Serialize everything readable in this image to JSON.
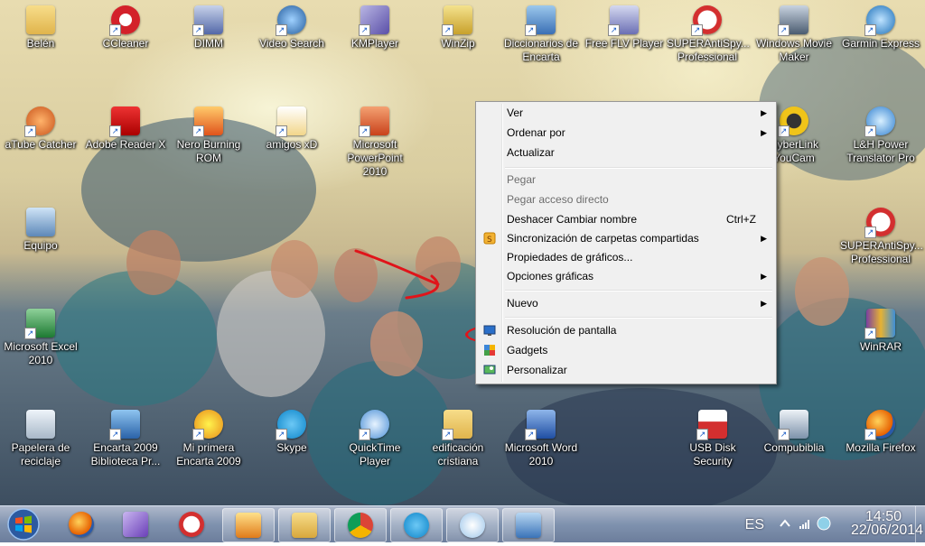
{
  "desktop": {
    "icons": [
      {
        "label": "Belén",
        "icon": "folder-icon"
      },
      {
        "label": "CCleaner",
        "icon": "ccleaner-icon"
      },
      {
        "label": "DIMM",
        "icon": "dimm-icon"
      },
      {
        "label": "Video Search",
        "icon": "video-search-icon"
      },
      {
        "label": "KMPlayer",
        "icon": "kmplayer-icon"
      },
      {
        "label": "WinZip",
        "icon": "winzip-icon"
      },
      {
        "label": "Diccionarios de Encarta",
        "icon": "encarta-dictionary-icon"
      },
      {
        "label": "Free FLV Player",
        "icon": "flv-player-icon"
      },
      {
        "label": "SUPERAntiSpy... Professional",
        "icon": "superantispyware-icon"
      },
      {
        "label": "Windows Movie Maker",
        "icon": "movie-maker-icon"
      },
      {
        "label": "Garmin Express",
        "icon": "garmin-icon"
      },
      {
        "label": "aTube Catcher",
        "icon": "atube-catcher-icon"
      },
      {
        "label": "Adobe Reader X",
        "icon": "adobe-reader-icon"
      },
      {
        "label": "Nero Burning ROM",
        "icon": "nero-icon"
      },
      {
        "label": "amigos xD",
        "icon": "image-file-icon"
      },
      {
        "label": "Microsoft PowerPoint 2010",
        "icon": "powerpoint-icon"
      },
      {
        "label": "CyberLink YouCam",
        "icon": "youcam-icon"
      },
      {
        "label": "L&H Power Translator Pro",
        "icon": "translator-icon"
      },
      {
        "label": "Equipo",
        "icon": "computer-icon"
      },
      {
        "label": "SUPERAntiSpy... Professional",
        "icon": "superantispyware-icon"
      },
      {
        "label": "Microsoft Excel 2010",
        "icon": "excel-icon"
      },
      {
        "label": "WinRAR",
        "icon": "winrar-icon"
      },
      {
        "label": "Papelera de reciclaje",
        "icon": "recycle-bin-icon"
      },
      {
        "label": "Encarta 2009 Biblioteca Pr...",
        "icon": "encarta-icon"
      },
      {
        "label": "Mi primera Encarta 2009",
        "icon": "encarta-kids-icon"
      },
      {
        "label": "Skype",
        "icon": "skype-icon"
      },
      {
        "label": "QuickTime Player",
        "icon": "quicktime-icon"
      },
      {
        "label": "edificación cristiana",
        "icon": "folder-icon"
      },
      {
        "label": "Microsoft Word 2010",
        "icon": "word-icon"
      },
      {
        "label": "USB Disk Security",
        "icon": "usb-security-icon"
      },
      {
        "label": "Compubiblia",
        "icon": "compubiblia-icon"
      },
      {
        "label": "Mozilla Firefox",
        "icon": "firefox-icon"
      }
    ]
  },
  "context_menu": {
    "items": [
      {
        "label": "Ver",
        "submenu": true
      },
      {
        "label": "Ordenar por",
        "submenu": true
      },
      {
        "label": "Actualizar"
      },
      {
        "label": "Pegar",
        "disabled": true
      },
      {
        "label": "Pegar acceso directo",
        "disabled": true
      },
      {
        "label": "Deshacer Cambiar nombre",
        "shortcut": "Ctrl+Z"
      },
      {
        "label": "Sincronización de carpetas compartidas",
        "submenu": true,
        "icon": "sync-icon"
      },
      {
        "label": "Propiedades de gráficos..."
      },
      {
        "label": "Opciones gráficas",
        "submenu": true
      },
      {
        "label": "Nuevo",
        "submenu": true
      },
      {
        "label": "Resolución de pantalla",
        "icon": "display-resolution-icon"
      },
      {
        "label": "Gadgets",
        "icon": "gadgets-icon"
      },
      {
        "label": "Personalizar",
        "icon": "personalize-icon"
      }
    ],
    "submenu_arrow": "▶"
  },
  "taskbar": {
    "pinned": [
      "firefox-icon",
      "visual-studio-icon",
      "superantispyware-icon",
      "media-player-icon",
      "explorer-icon",
      "chrome-icon",
      "skype-icon",
      "paint-icon",
      "control-panel-icon"
    ],
    "language": "ES",
    "time": "14:50",
    "date": "22/06/2014"
  },
  "colors": {
    "annotation": "#e0141a",
    "accent": "#1a5bc4"
  }
}
